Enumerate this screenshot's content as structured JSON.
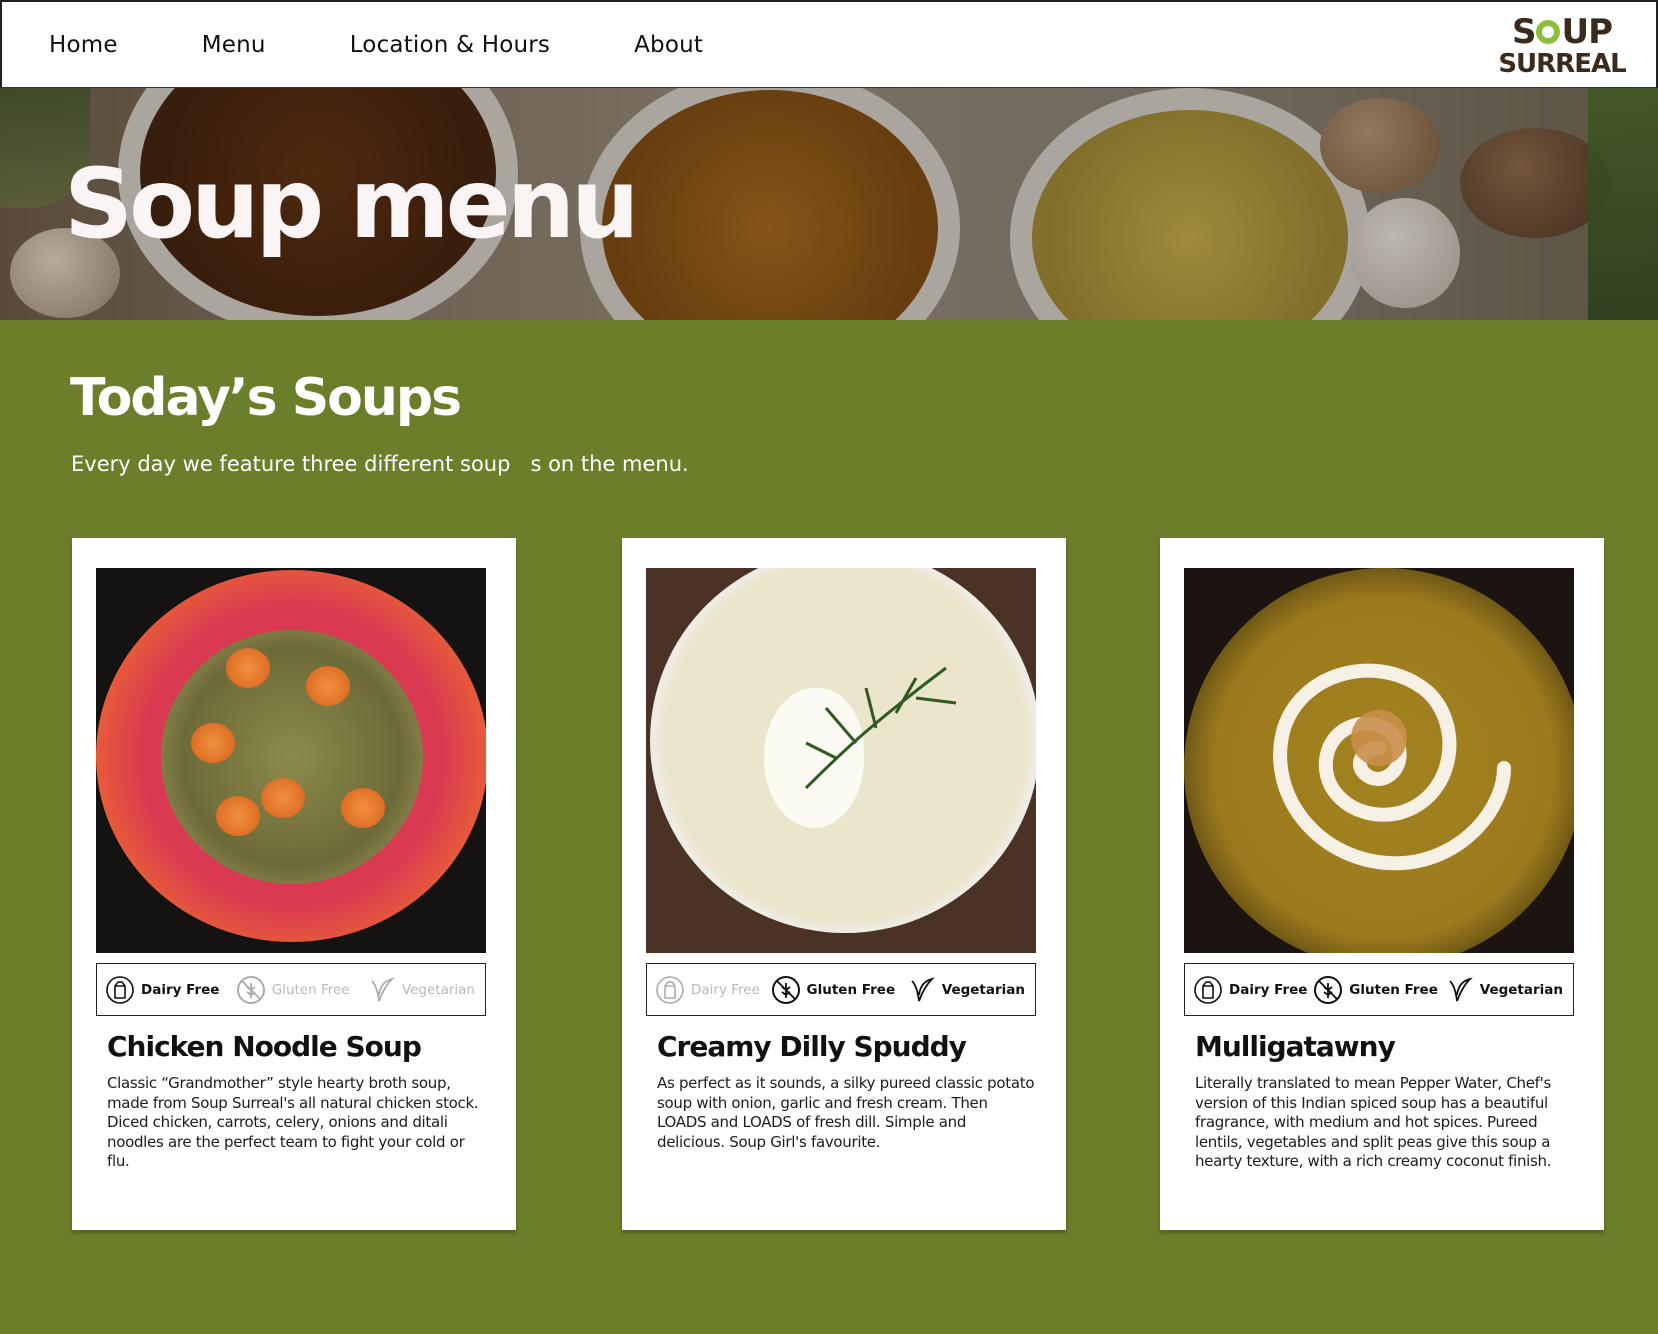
{
  "nav": {
    "links": [
      {
        "label": "Home"
      },
      {
        "label": "Menu"
      },
      {
        "label": "Location & Hours"
      },
      {
        "label": "About"
      }
    ],
    "logo": {
      "line1": "SOUP",
      "line2": "SURREAL"
    }
  },
  "hero": {
    "title": "Soup menu"
  },
  "section": {
    "title": "Today’s Soups",
    "subtitle": "Every day we feature three different soup   s on the menu."
  },
  "tag_labels": {
    "dairy_free": "Dairy Free",
    "gluten_free": "Gluten Free",
    "vegetarian": "Vegetarian"
  },
  "soups": [
    {
      "name": "Chicken Noodle Soup",
      "description": "Classic “Grandmother” style hearty broth soup, made from Soup Surreal's all natural chicken stock. Diced chicken, carrots, celery, onions and ditali noodles are the perfect team to fight your cold or flu.",
      "tags": {
        "dairy_free": true,
        "gluten_free": false,
        "vegetarian": false
      }
    },
    {
      "name": "Creamy Dilly Spuddy",
      "description": "As perfect as it sounds, a silky pureed classic potato soup with onion, garlic and fresh cream. Then LOADS and LOADS of fresh dill. Simple and delicious. Soup Girl's favourite.",
      "tags": {
        "dairy_free": false,
        "gluten_free": true,
        "vegetarian": true
      }
    },
    {
      "name": "Mulligatawny",
      "description": "Literally translated to mean Pepper Water, Chef's version of this Indian spiced soup has a beautiful fragrance, with medium and hot spices. Pureed lentils, vegetables and split peas give this soup a hearty texture, with a rich creamy coconut finish.",
      "tags": {
        "dairy_free": true,
        "gluten_free": true,
        "vegetarian": true
      }
    }
  ],
  "colors": {
    "page_background": "#6b7f2a",
    "hero_title": "#fbf4f4",
    "logo_brown": "#3b2a1e",
    "logo_green": "#8cbf3f"
  }
}
